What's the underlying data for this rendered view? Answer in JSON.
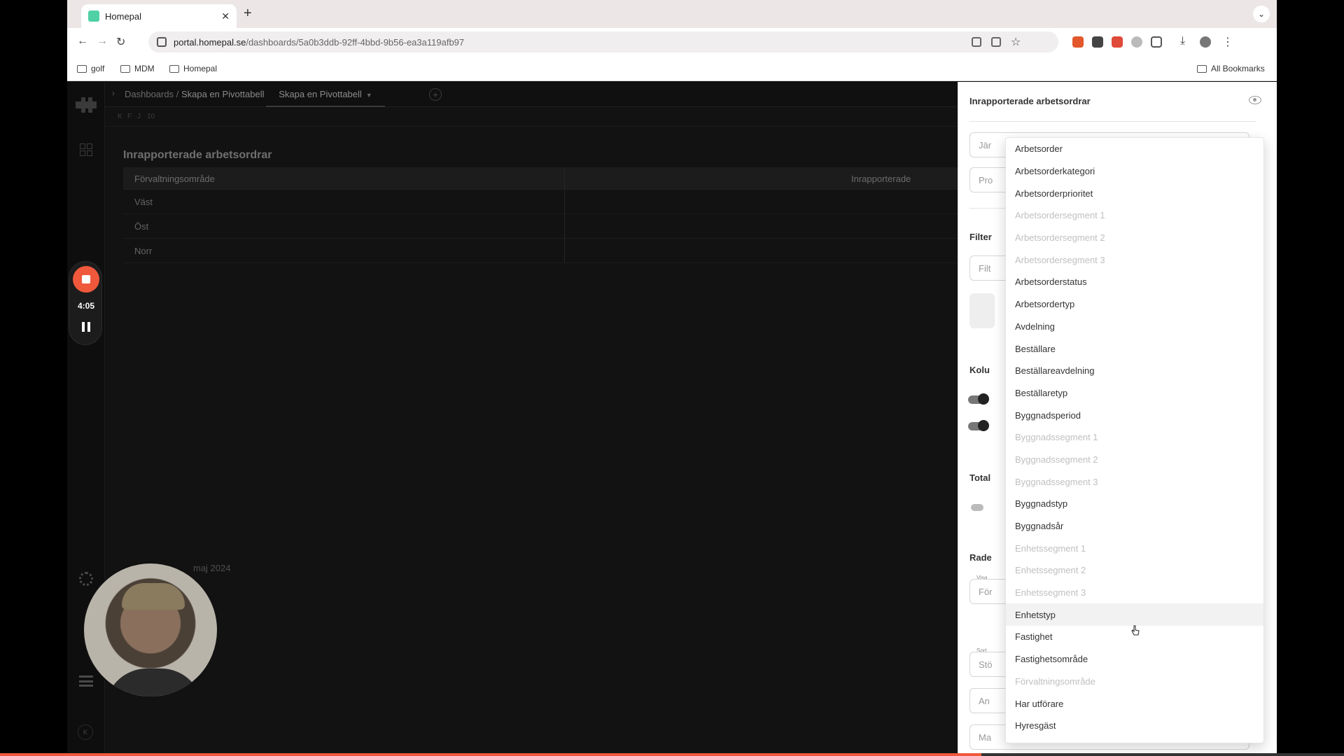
{
  "browser": {
    "tab_title": "Homepal",
    "tab_close": "✕",
    "new_tab": "+",
    "tab_menu": "⌄",
    "url_host": "portal.homepal.se",
    "url_path": "/dashboards/5a0b3ddb-92ff-4bbd-9b56-ea3a119afb97",
    "bookmarks": [
      "golf",
      "MDM",
      "Homepal"
    ],
    "all_bookmarks": "All Bookmarks"
  },
  "app": {
    "breadcrumb_root": "Dashboards /",
    "breadcrumb_current": "Skapa en Pivottabell",
    "active_tab": "Skapa en Pivottabell",
    "subbar_buttons": [
      "K",
      "F",
      "J",
      "10"
    ],
    "widget_title": "Inrapporterade arbetsordrar",
    "table": {
      "headers": [
        "Förvaltningsområde",
        "Inrapporterade"
      ],
      "rows": [
        "Väst",
        "Öst",
        "Norr"
      ]
    },
    "date_footer": "maj 2024",
    "collapse_label": "K"
  },
  "recorder": {
    "time": "4:05",
    "progress": 0.73
  },
  "panel": {
    "title": "Inrapporterade arbetsordrar",
    "field1": "Jär",
    "field2": "Pro",
    "filter_label": "Filter",
    "filter_field": "Filt",
    "kolumn_label": "Kolu",
    "total_label": "Total",
    "rader_label": "Rade",
    "visa_label": "Visa",
    "visa_field": "För",
    "sort_label": "Sort",
    "sort_field": "Stö",
    "an_field": "An",
    "ma_field": "Ma"
  },
  "dropdown": {
    "options": [
      {
        "label": "Arbetsorder",
        "disabled": false
      },
      {
        "label": "Arbetsorderkategori",
        "disabled": false
      },
      {
        "label": "Arbetsorderprioritet",
        "disabled": false
      },
      {
        "label": "Arbetsordersegment 1",
        "disabled": true
      },
      {
        "label": "Arbetsordersegment 2",
        "disabled": true
      },
      {
        "label": "Arbetsordersegment 3",
        "disabled": true
      },
      {
        "label": "Arbetsorderstatus",
        "disabled": false
      },
      {
        "label": "Arbetsordertyp",
        "disabled": false
      },
      {
        "label": "Avdelning",
        "disabled": false
      },
      {
        "label": "Beställare",
        "disabled": false
      },
      {
        "label": "Beställareavdelning",
        "disabled": false
      },
      {
        "label": "Beställaretyp",
        "disabled": false
      },
      {
        "label": "Byggnadsperiod",
        "disabled": false
      },
      {
        "label": "Byggnadssegment 1",
        "disabled": true
      },
      {
        "label": "Byggnadssegment 2",
        "disabled": true
      },
      {
        "label": "Byggnadssegment 3",
        "disabled": true
      },
      {
        "label": "Byggnadstyp",
        "disabled": false
      },
      {
        "label": "Byggnadsår",
        "disabled": false
      },
      {
        "label": "Enhetssegment 1",
        "disabled": true
      },
      {
        "label": "Enhetssegment 2",
        "disabled": true
      },
      {
        "label": "Enhetssegment 3",
        "disabled": true
      },
      {
        "label": "Enhetstyp",
        "disabled": false,
        "hover": true
      },
      {
        "label": "Fastighet",
        "disabled": false
      },
      {
        "label": "Fastighetsområde",
        "disabled": false
      },
      {
        "label": "Förvaltningsområde",
        "disabled": true
      },
      {
        "label": "Har utförare",
        "disabled": false
      },
      {
        "label": "Hyresgäst",
        "disabled": false
      }
    ]
  }
}
